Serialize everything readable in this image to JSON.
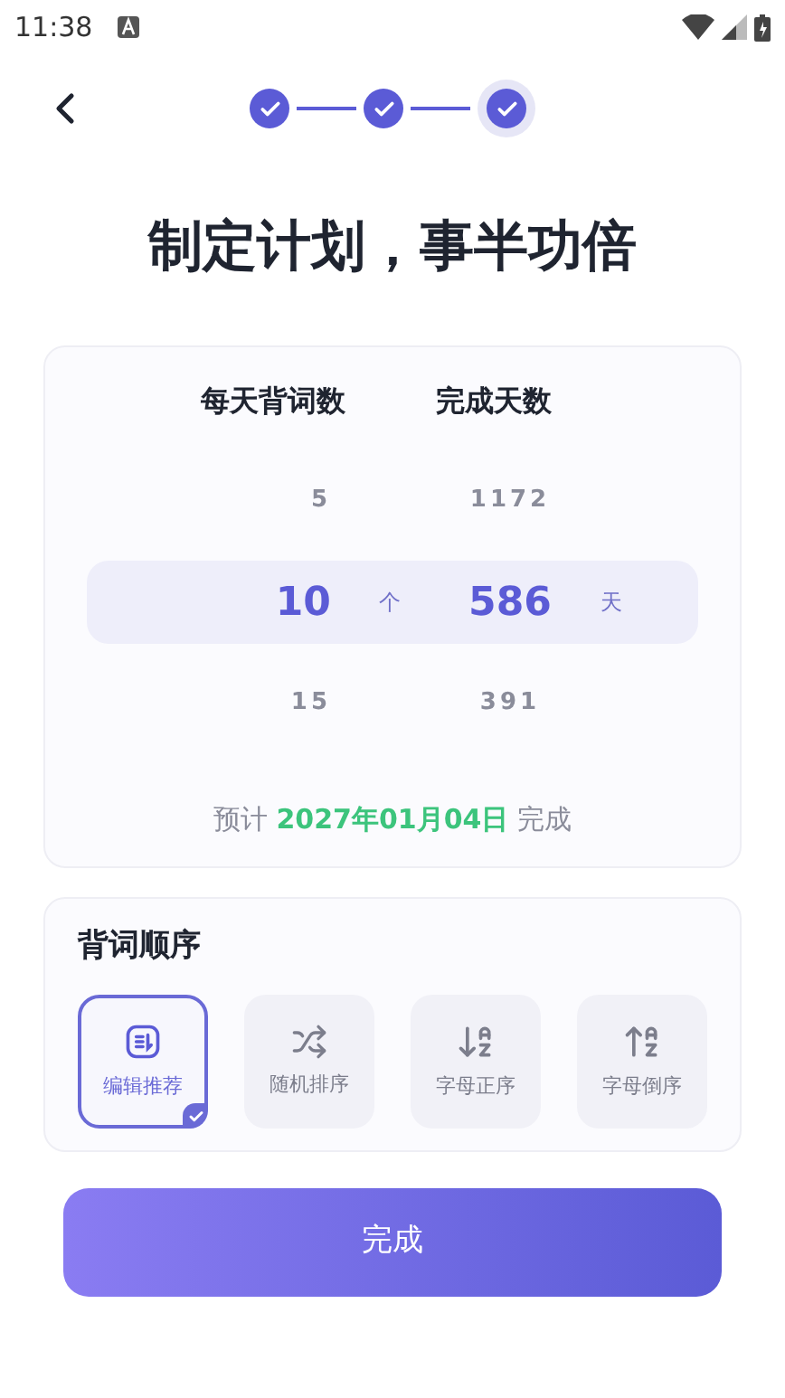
{
  "status_bar": {
    "time": "11:38"
  },
  "steps": [
    {
      "done": true,
      "current": false
    },
    {
      "done": true,
      "current": false
    },
    {
      "done": true,
      "current": true
    }
  ],
  "title": "制定计划，事半功倍",
  "plan": {
    "columns": [
      "每天背词数",
      "完成天数"
    ],
    "rows": [
      {
        "words": "5",
        "days": "1172",
        "selected": false
      },
      {
        "words": "10",
        "words_unit": "个",
        "days": "586",
        "days_unit": "天",
        "selected": true
      },
      {
        "words": "15",
        "days": "391",
        "selected": false
      }
    ],
    "estimate": {
      "prefix": "预计",
      "date": "2027年01月04日",
      "suffix": "完成"
    }
  },
  "order": {
    "title": "背词顺序",
    "options": [
      {
        "kind": "recommended",
        "label": "编辑推荐",
        "selected": true
      },
      {
        "kind": "random",
        "label": "随机排序",
        "selected": false
      },
      {
        "kind": "az",
        "label": "字母正序",
        "selected": false
      },
      {
        "kind": "za",
        "label": "字母倒序",
        "selected": false
      }
    ]
  },
  "submit": "完成"
}
